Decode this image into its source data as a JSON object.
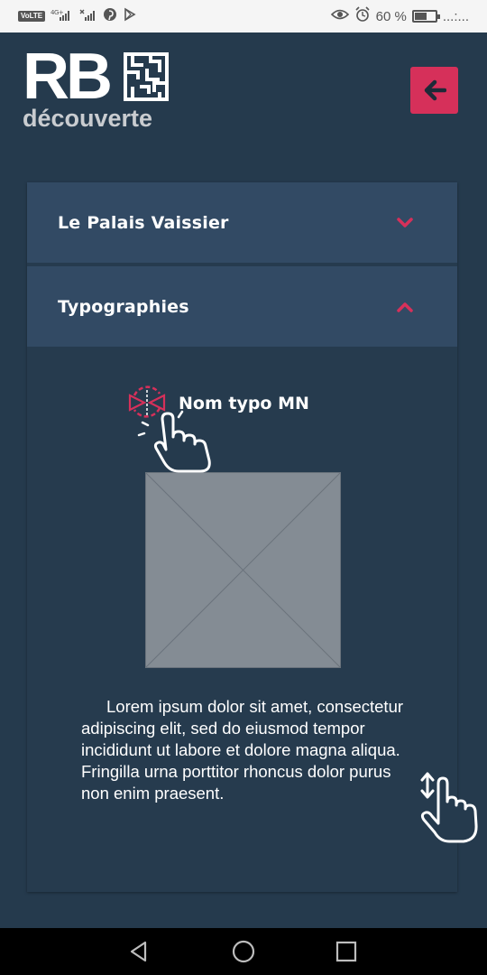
{
  "status_bar": {
    "volte": "VoLTE",
    "signal_1": "4G+",
    "battery_percent": "60 %",
    "battery_level": 0.6,
    "overflow": "...:..."
  },
  "header": {
    "logo_main": "RB",
    "logo_sub": "découverte",
    "back_icon": "arrow-left-icon",
    "accent": "#d6305a"
  },
  "accordion": {
    "sections": [
      {
        "title": "Le Palais Vaissier",
        "expanded": false,
        "icon": "chevron-down-icon"
      },
      {
        "title": "Typographies",
        "expanded": true,
        "icon": "chevron-up-icon"
      }
    ],
    "content": {
      "typo_name": "Nom typo MN",
      "rotate_icon": "rotate-icon",
      "tap_icon": "hand-tap-icon",
      "image_icon": "image-placeholder",
      "text": "Lorem ipsum dolor sit amet, consectetur adipiscing elit, sed do eiusmod tempor incididunt ut labore et dolore magna aliqua. Fringilla urna porttitor rhoncus dolor purus non enim praesent.",
      "scroll_icon": "hand-scroll-icon"
    }
  },
  "nav": {
    "back": "nav-back-icon",
    "home": "nav-home-icon",
    "recents": "nav-recents-icon"
  }
}
